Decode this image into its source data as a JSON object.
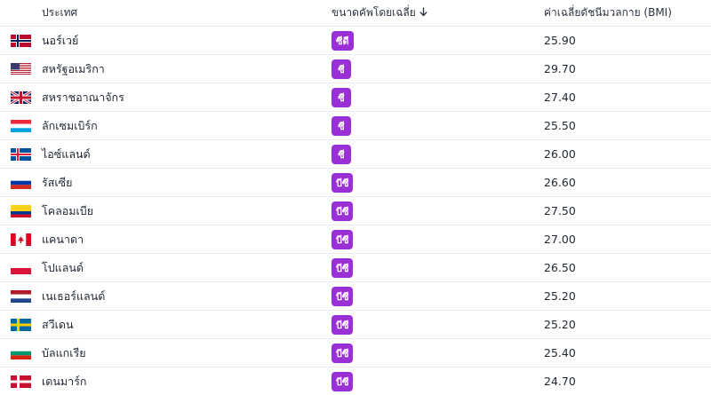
{
  "columns": {
    "country": "ประเทศ",
    "size": "ขนาดคัพโดยเฉลี่ย",
    "size_sort_icon": "arrow-down-icon",
    "bmi": "ค่าเฉลี่ยดัชนีมวลกาย (BMI)"
  },
  "rows": [
    {
      "flag": "norway-flag",
      "country": "นอร์เวย์",
      "cup": "ซีดี",
      "bmi": "25.90"
    },
    {
      "flag": "usa-flag",
      "country": "สหรัฐอเมริกา",
      "cup": "ซี",
      "bmi": "29.70"
    },
    {
      "flag": "uk-flag",
      "country": "สหราชอาณาจักร",
      "cup": "ซี",
      "bmi": "27.40"
    },
    {
      "flag": "luxembourg-flag",
      "country": "ลักเซมเบิร์ก",
      "cup": "ซี",
      "bmi": "25.50"
    },
    {
      "flag": "iceland-flag",
      "country": "ไอซ์แลนด์",
      "cup": "ซี",
      "bmi": "26.00"
    },
    {
      "flag": "russia-flag",
      "country": "รัสเซีย",
      "cup": "บีซี",
      "bmi": "26.60"
    },
    {
      "flag": "colombia-flag",
      "country": "โคลอมเบีย",
      "cup": "บีซี",
      "bmi": "27.50"
    },
    {
      "flag": "canada-flag",
      "country": "แคนาดา",
      "cup": "บีซี",
      "bmi": "27.00"
    },
    {
      "flag": "poland-flag",
      "country": "โปแลนด์",
      "cup": "บีซี",
      "bmi": "26.50"
    },
    {
      "flag": "netherlands-flag",
      "country": "เนเธอร์แลนด์",
      "cup": "บีซี",
      "bmi": "25.20"
    },
    {
      "flag": "sweden-flag",
      "country": "สวีเดน",
      "cup": "บีซี",
      "bmi": "25.20"
    },
    {
      "flag": "bulgaria-flag",
      "country": "บัลแกเรีย",
      "cup": "บีซี",
      "bmi": "25.40"
    },
    {
      "flag": "denmark-flag",
      "country": "เดนมาร์ก",
      "cup": "บีซี",
      "bmi": "24.70"
    }
  ],
  "colors": {
    "badge": "#9b2fd6",
    "border": "#e8eaee"
  }
}
